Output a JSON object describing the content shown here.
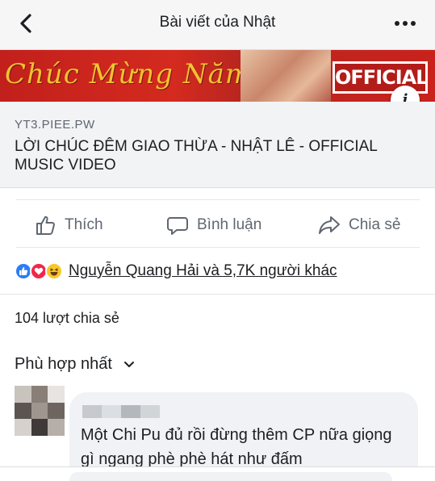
{
  "header": {
    "title": "Bài viết của Nhật"
  },
  "icons": {
    "back": "chevron-left-icon",
    "more": "more-horizontal-icon",
    "info": "info-icon",
    "like": "thumbs-up-icon",
    "comment": "comment-icon",
    "share": "share-arrow-icon",
    "sort": "chevron-down-icon"
  },
  "banner": {
    "script_text": "Chúc Mừng Năm M",
    "official_label": "OFFICIAL",
    "info_label": "i"
  },
  "link_card": {
    "domain": "YT3.PIEE.PW",
    "title": "LỜI CHÚC ĐÊM GIAO THỪA - NHẬT LÊ - OFFICIAL MUSIC VIDEO"
  },
  "actions": {
    "like_label": "Thích",
    "comment_label": "Bình luận",
    "share_label": "Chia sẻ"
  },
  "reactions": {
    "types": [
      "like",
      "love",
      "haha"
    ],
    "names_text": "Nguyễn Quang Hải và 5,7K người khác"
  },
  "shares_text": "104 lượt chia sẻ",
  "sort_label": "Phù hợp nhất",
  "comment": {
    "text": "Một Chi Pu đủ rồi đừng thêm CP nữa giọng gì ngang phè phè hát như đấm"
  },
  "colors": {
    "accent_blue": "#2d7cf6",
    "love_red": "#f0284a",
    "haha_yellow": "#f7c829",
    "banner_red": "#c2201c",
    "banner_gold": "#f2c230"
  }
}
